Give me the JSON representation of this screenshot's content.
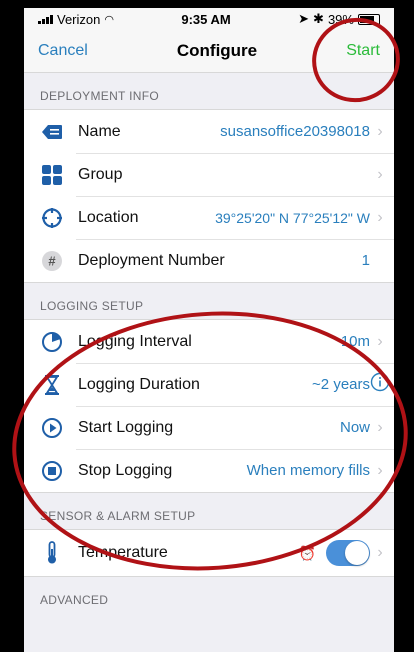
{
  "status_bar": {
    "carrier": "Verizon",
    "time": "9:35 AM",
    "battery": "39%"
  },
  "nav": {
    "cancel": "Cancel",
    "title": "Configure",
    "start": "Start"
  },
  "sections": {
    "deployment": {
      "header": "DEPLOYMENT INFO",
      "name_label": "Name",
      "name_value": "susansoffice20398018",
      "group_label": "Group",
      "location_label": "Location",
      "location_value": "39°25'20\" N 77°25'12\" W",
      "deployment_number_label": "Deployment Number",
      "deployment_number_value": "1"
    },
    "logging": {
      "header": "LOGGING SETUP",
      "interval_label": "Logging Interval",
      "interval_value": "10m",
      "duration_label": "Logging Duration",
      "duration_value": "~2 years",
      "start_label": "Start Logging",
      "start_value": "Now",
      "stop_label": "Stop Logging",
      "stop_value": "When memory fills"
    },
    "sensor": {
      "header": "SENSOR & ALARM SETUP",
      "temperature_label": "Temperature"
    },
    "advanced": {
      "header": "ADVANCED"
    }
  },
  "colors": {
    "accent": "#2a7fbd",
    "start_green": "#2bbb3a",
    "annotation_red": "#b01216"
  }
}
